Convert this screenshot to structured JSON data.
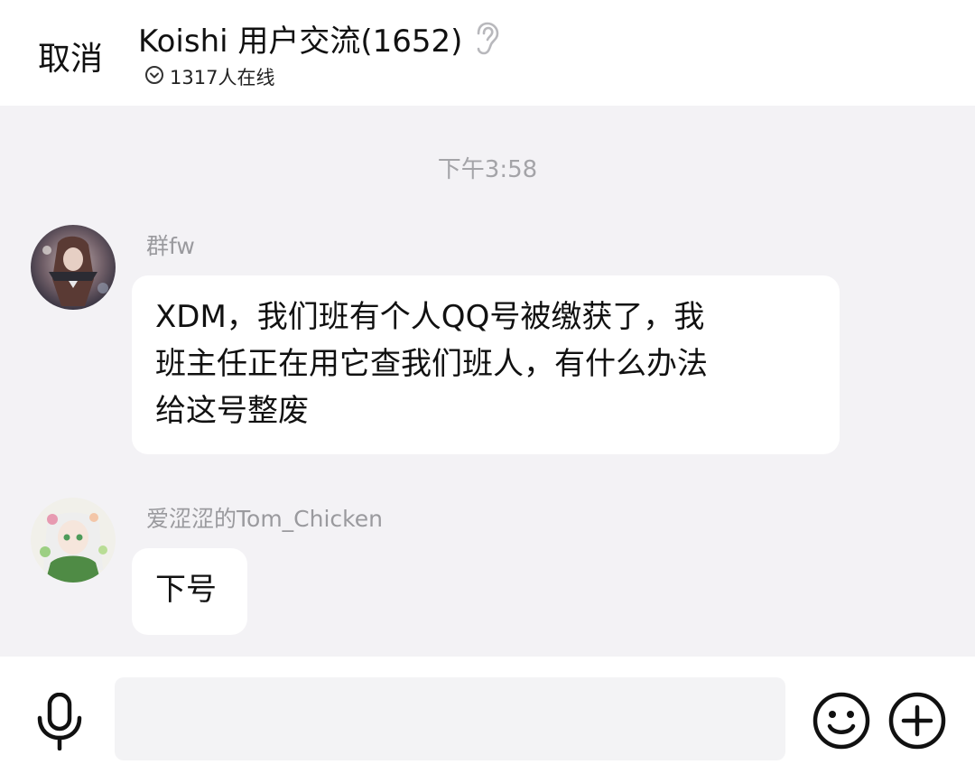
{
  "header": {
    "cancel_label": "取消",
    "group_title": "Koishi 用户交流(1652)",
    "online_status": "1317人在线"
  },
  "chat": {
    "timestamp": "下午3:58",
    "messages": [
      {
        "sender": "群fw",
        "lines": [
          "XDM，我们班有个人QQ号被缴获了，我",
          "班主任正在用它查我们班人，有什么办法",
          "给这号整废"
        ]
      },
      {
        "sender": "爱涩涩的Tom_Chicken",
        "lines": [
          "下号"
        ]
      }
    ]
  },
  "input_bar": {
    "placeholder": "",
    "icons": [
      "microphone-icon",
      "emoji-icon",
      "plus-icon"
    ]
  },
  "colors": {
    "chat_background": "#f3f2f5",
    "bubble": "#ffffff",
    "secondary_text": "#9a9a9e"
  }
}
